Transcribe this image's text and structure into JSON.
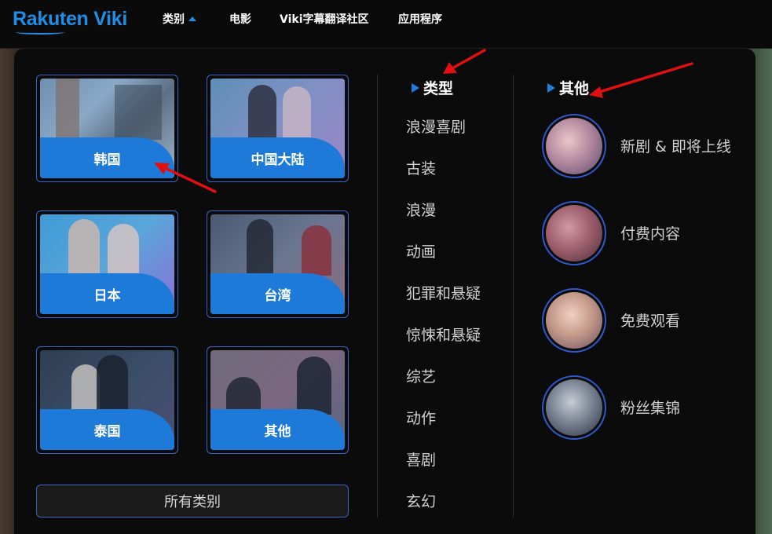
{
  "brand": {
    "logo_text": "Rakuten Viki",
    "accent": "#1e8fe6"
  },
  "nav": {
    "items": [
      {
        "label": "类别",
        "active": true
      },
      {
        "label": "电影"
      },
      {
        "label": "Viki字幕翻译社区"
      },
      {
        "label": "应用程序"
      }
    ]
  },
  "regions": {
    "cards": [
      {
        "label": "韩国"
      },
      {
        "label": "中国大陆"
      },
      {
        "label": "日本"
      },
      {
        "label": "台湾"
      },
      {
        "label": "泰国"
      },
      {
        "label": "其他"
      }
    ],
    "all_button": "所有类别"
  },
  "genres": {
    "heading": "类型",
    "items": [
      "浪漫喜剧",
      "古装",
      "浪漫",
      "动画",
      "犯罪和悬疑",
      "惊悚和悬疑",
      "综艺",
      "动作",
      "喜剧",
      "玄幻"
    ]
  },
  "other": {
    "heading": "其他",
    "items": [
      {
        "label": "新剧 & 即将上线"
      },
      {
        "label": "付费内容"
      },
      {
        "label": "免费观看"
      },
      {
        "label": "粉丝集锦"
      }
    ]
  },
  "colors": {
    "card_label_bg": "#1d7ad8",
    "border": "#3c63c8",
    "annotation_arrow": "#e01010"
  }
}
